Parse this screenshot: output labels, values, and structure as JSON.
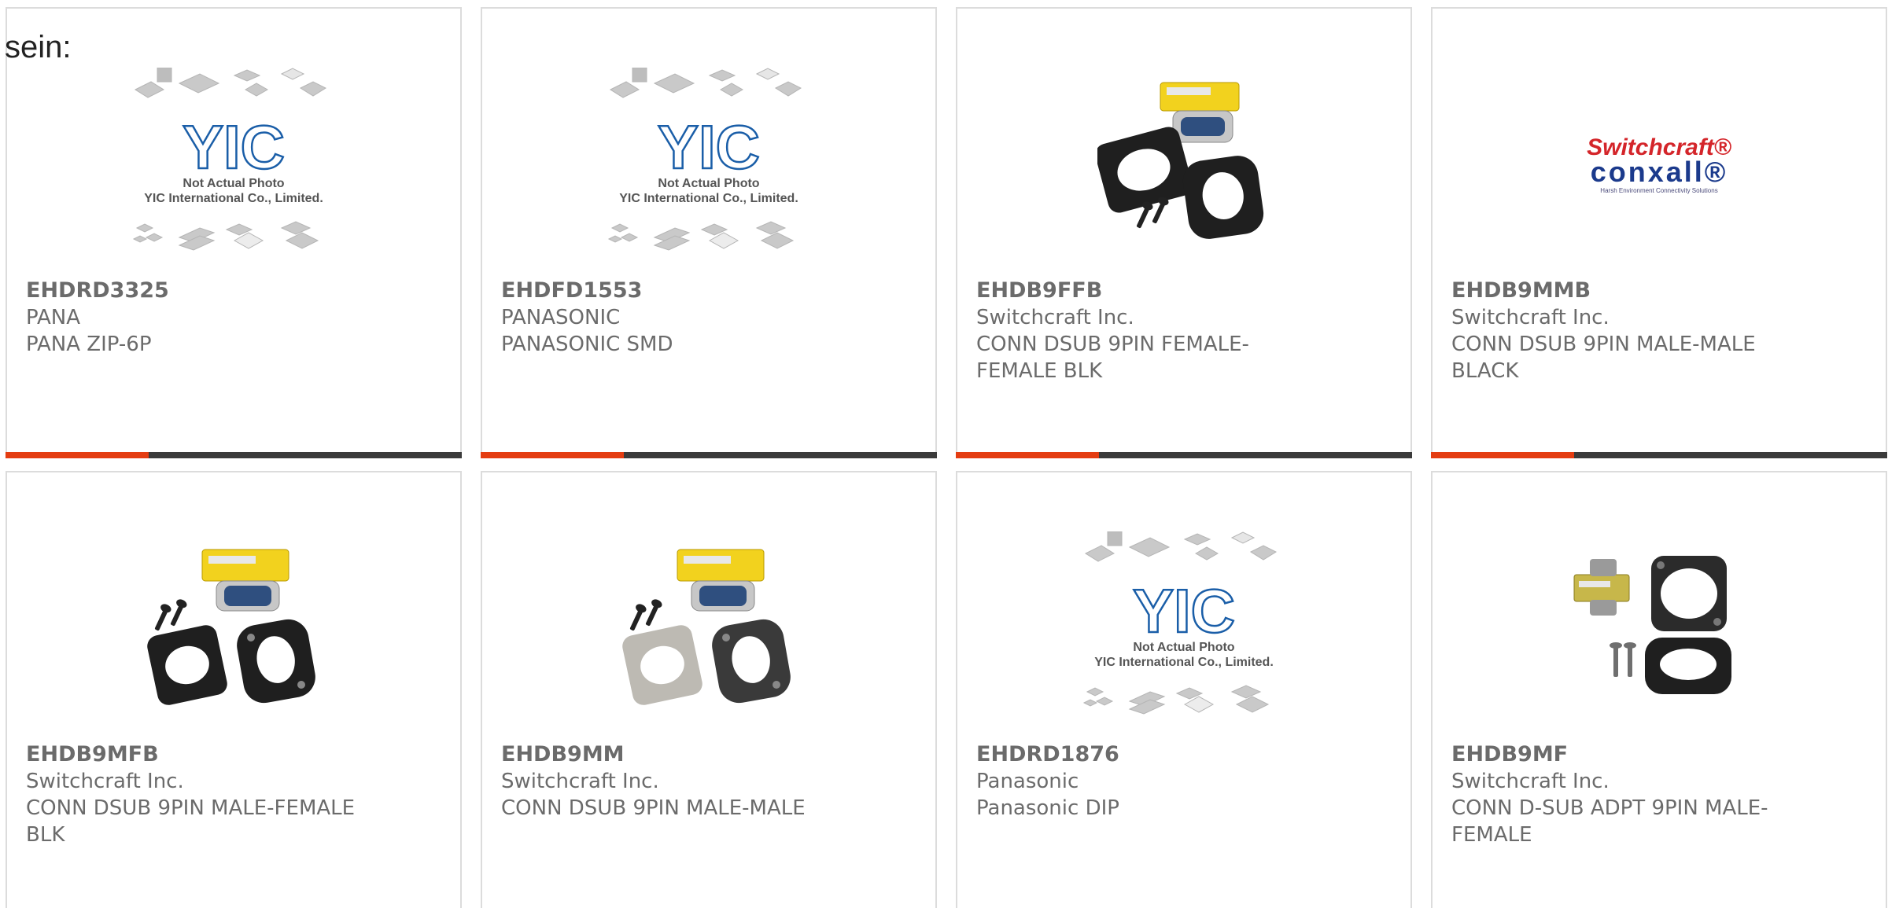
{
  "intro_text": "sein:",
  "placeholder": {
    "caption_line1": "Not Actual Photo",
    "caption_line2": "YIC International Co., Limited.",
    "logo_text": "YIC"
  },
  "switchcraft_logo": {
    "line1": "Switchcraft",
    "line2": "conxall",
    "tagline": "Harsh Environment Connectivity Solutions"
  },
  "colors": {
    "accent": "#e43d12",
    "bar": "#3b3b3b",
    "text": "#6b6b6b",
    "border": "#dcdcdc",
    "yic_blue": "#1a5ea8",
    "switchcraft_red": "#d4252a",
    "conxall_blue": "#1b3a8c"
  },
  "products": [
    {
      "part": "EHDRD3325",
      "manufacturer": "PANA",
      "description": "PANA ZIP-6P",
      "image": "placeholder"
    },
    {
      "part": "EHDFD1553",
      "manufacturer": "PANASONIC",
      "description": "PANASONIC SMD",
      "image": "placeholder"
    },
    {
      "part": "EHDB9FFB",
      "manufacturer": "Switchcraft Inc.",
      "description": "CONN DSUB 9PIN FEMALE-\nFEMALE BLK",
      "image": "dsub-female-kit"
    },
    {
      "part": "EHDB9MMB",
      "manufacturer": "Switchcraft Inc.",
      "description": "CONN DSUB 9PIN MALE-MALE\nBLACK",
      "image": "switchcraft-logo"
    },
    {
      "part": "EHDB9MFB",
      "manufacturer": "Switchcraft Inc.",
      "description": "CONN DSUB 9PIN MALE-FEMALE\nBLK",
      "image": "dsub-male-kit-black"
    },
    {
      "part": "EHDB9MM",
      "manufacturer": "Switchcraft Inc.",
      "description": "CONN DSUB 9PIN MALE-MALE",
      "image": "dsub-male-kit-silver"
    },
    {
      "part": "EHDRD1876",
      "manufacturer": "Panasonic",
      "description": "Panasonic DIP",
      "image": "placeholder"
    },
    {
      "part": "EHDB9MF",
      "manufacturer": "Switchcraft Inc.",
      "description": "CONN D-SUB ADPT 9PIN MALE-\nFEMALE",
      "image": "dsub-adapter-side"
    }
  ]
}
